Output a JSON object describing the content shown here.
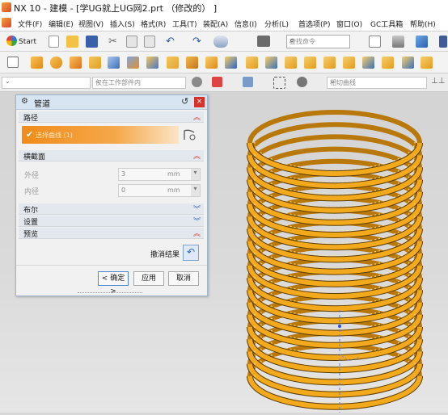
{
  "window": {
    "title": "NX 10 - 建模 - [学UG就上UG网2.prt （修改的） ]"
  },
  "menubar": {
    "items": [
      "文件(F)",
      "编辑(E)",
      "视图(V)",
      "插入(S)",
      "格式(R)",
      "工具(T)",
      "装配(A)",
      "信息(I)",
      "分析(L)",
      "首选项(P)",
      "窗口(O)",
      "GC工具箱",
      "帮助(H)"
    ]
  },
  "toolbar": {
    "start_label": "Start",
    "command_search_placeholder": "查找命令"
  },
  "selection_bar": {
    "filter_value": "仅在工作部件内",
    "curve_rule_value": "相切曲线"
  },
  "dialog": {
    "title": "管道",
    "sections": {
      "path": "路径",
      "cross_section": "横截面",
      "boolean": "布尔",
      "settings": "设置",
      "preview": "预览"
    },
    "path_select_label": "选择曲线 (1)",
    "outer_diameter": {
      "label": "外径",
      "value": "3",
      "unit": "mm"
    },
    "inner_diameter": {
      "label": "内径",
      "value": "0",
      "unit": "mm"
    },
    "undo_result_label": "撤消结果",
    "buttons": {
      "ok": "< 确定 >",
      "apply": "应用",
      "cancel": "取消"
    }
  },
  "colors": {
    "coil": "#f2a91c",
    "coil_dark": "#b9780a",
    "path_highlight": "#f08c1a",
    "annotation_arrow": "#e53935"
  }
}
